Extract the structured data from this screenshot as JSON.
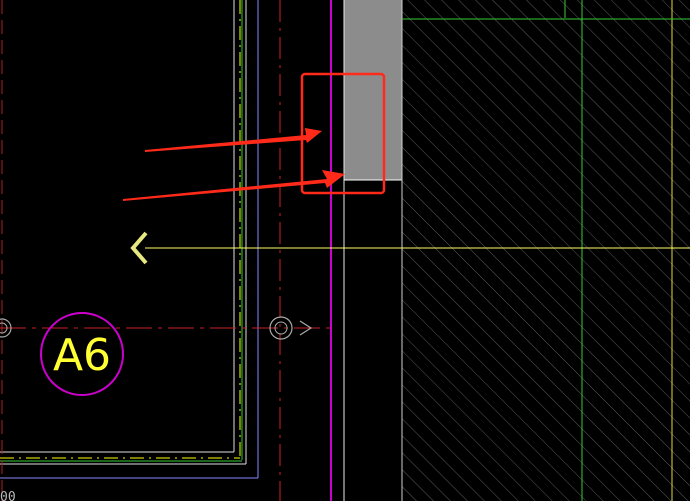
{
  "drawing": {
    "axis_bubble_label": "A6",
    "bottom_edge_label": "00",
    "colors": {
      "background": "#000000",
      "column_fill": "#8c8c8c",
      "hatch": "#5a5a5a",
      "axis_bubble": "#cc00cc",
      "axis_text": "#ffff33",
      "axis_line": "#cc2222",
      "wall_lines": "#e0e0e0",
      "dim_line": "#ffff00",
      "green_line": "#33cc33",
      "magenta_line": "#cc00cc",
      "purple_line": "#8888ff",
      "highlight_box": "#ff2a1a",
      "arrow": "#ff2a1a",
      "cursor_chevron": "#e8e880"
    },
    "icons": [
      "chevron-left-icon",
      "axis-bubble-icon",
      "small-circle-icon",
      "arrow-icon"
    ]
  }
}
